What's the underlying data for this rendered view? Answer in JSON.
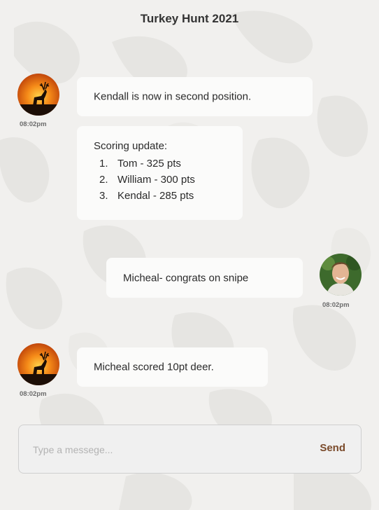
{
  "header": {
    "title": "Turkey Hunt 2021"
  },
  "colors": {
    "accent": "#7a4a2a",
    "bubble": "#fbfbfa",
    "background": "#f1f0ee"
  },
  "messages": [
    {
      "sender": "left",
      "avatar": "deer-sunset-avatar",
      "time": "08:02pm",
      "text": "Kendall is now in second position."
    },
    {
      "sender": "left",
      "heading": "Scoring update:",
      "items": [
        {
          "num": "1.",
          "text": "Tom - 325 pts"
        },
        {
          "num": "2.",
          "text": "William - 300 pts"
        },
        {
          "num": "3.",
          "text": "Kendal - 285 pts"
        }
      ]
    },
    {
      "sender": "right",
      "avatar": "user-photo-avatar",
      "time": "08:02pm",
      "text": "Micheal- congrats on snipe"
    },
    {
      "sender": "left",
      "avatar": "deer-sunset-avatar",
      "time": "08:02pm",
      "text": "Micheal scored 10pt deer."
    }
  ],
  "composer": {
    "placeholder": "Type a messege...",
    "send_label": "Send"
  }
}
